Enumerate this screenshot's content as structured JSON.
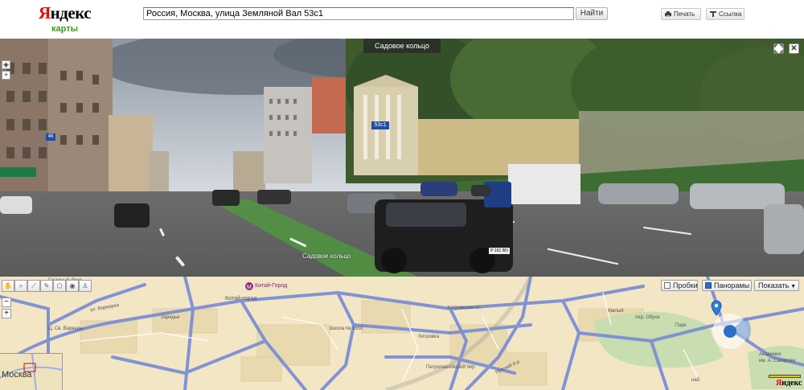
{
  "header": {
    "logo_first_letter": "Я",
    "logo_rest": "ндекс",
    "logo_sub": "карты",
    "search_value": "Россия, Москва, улица Земляной Вал 53с1",
    "search_button": "Найти",
    "print_label": "Печать",
    "link_label": "Ссылка"
  },
  "panorama": {
    "street_top": "Садовое кольцо",
    "street_bottom": "Садовое кольцо",
    "house_sign": "53с1",
    "house_sign_left": "46",
    "license_plate": "Р 161 ВО"
  },
  "map": {
    "traffic_label": "Пробки",
    "panoramas_label": "Панорамы",
    "show_label": "Показать",
    "minimap_label": "Москва",
    "copyright_first": "Я",
    "copyright_rest": "ндекс",
    "labels": {
      "gostiny_dvor": "Гостиный Двор",
      "kitay_gorod_metro": "Китай-Город",
      "kitay_gorod": "Китай-город",
      "varvarka": "ул. Варварка",
      "st_varvary": "Ц. Св. Варвары",
      "zaryadye": "Зарядье",
      "school": "Школа № 1650",
      "khitrovka": "Хитровка",
      "khitrovskaya": "Хитровская пл.",
      "petropavlovsky": "Петропавловский пер.",
      "yauza": "Яузский б-р",
      "nab": "наб.",
      "maly": "Малый",
      "obukha": "пер. Обуха",
      "park": "Парк",
      "academy": "Академия",
      "sakharov": "им. А. Сахарова"
    }
  }
}
